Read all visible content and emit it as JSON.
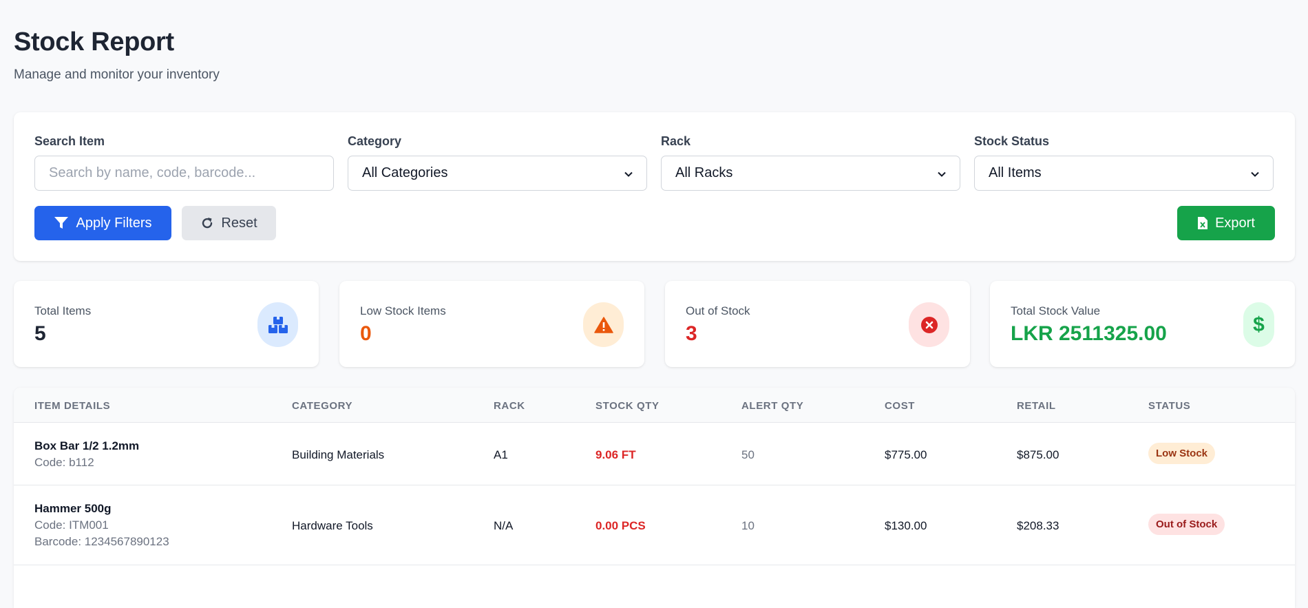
{
  "header": {
    "title": "Stock Report",
    "subtitle": "Manage and monitor your inventory"
  },
  "filters": {
    "search_label": "Search Item",
    "search_placeholder": "Search by name, code, barcode...",
    "search_value": "",
    "category_label": "Category",
    "category_value": "All Categories",
    "rack_label": "Rack",
    "rack_value": "All Racks",
    "status_label": "Stock Status",
    "status_value": "All Items",
    "apply_label": "Apply Filters",
    "reset_label": "Reset",
    "export_label": "Export"
  },
  "stats": [
    {
      "label": "Total Items",
      "value": "5",
      "color": "#1e2533",
      "icon": "boxes-icon",
      "icon_bg": "#dbeafe",
      "icon_color": "#2563eb"
    },
    {
      "label": "Low Stock Items",
      "value": "0",
      "color": "#ea580c",
      "icon": "warning-icon",
      "icon_bg": "#ffedd5",
      "icon_color": "#ea580c"
    },
    {
      "label": "Out of Stock",
      "value": "3",
      "color": "#dc2626",
      "icon": "x-circle-icon",
      "icon_bg": "#fee2e2",
      "icon_color": "#dc2626"
    },
    {
      "label": "Total Stock Value",
      "value": "LKR 2511325.00",
      "color": "#16a34a",
      "icon": "dollar-icon",
      "icon_bg": "#dcfce7",
      "icon_color": "#16a34a"
    }
  ],
  "table": {
    "columns": [
      "ITEM DETAILS",
      "CATEGORY",
      "RACK",
      "STOCK QTY",
      "ALERT QTY",
      "COST",
      "RETAIL",
      "STATUS"
    ],
    "rows": [
      {
        "name": "Box Bar 1/2 1.2mm",
        "code": "Code: b112",
        "barcode": "",
        "category": "Building Materials",
        "rack": "A1",
        "stock_qty": "9.06 FT",
        "alert_qty": "50",
        "cost": "$775.00",
        "retail": "$875.00",
        "status": "Low Stock"
      },
      {
        "name": "Hammer 500g",
        "code": "Code: ITM001",
        "barcode": "Barcode: 1234567890123",
        "category": "Hardware Tools",
        "rack": "N/A",
        "stock_qty": "0.00 PCS",
        "alert_qty": "10",
        "cost": "$130.00",
        "retail": "$208.33",
        "status": "Out of Stock"
      }
    ]
  },
  "colors": {
    "primary": "#2563eb",
    "success": "#16a34a",
    "danger": "#dc2626",
    "warning": "#ea580c",
    "low_badge_bg": "#ffedd5",
    "low_badge_text": "#9a3412",
    "out_badge_bg": "#fee2e2",
    "out_badge_text": "#991b1b"
  }
}
